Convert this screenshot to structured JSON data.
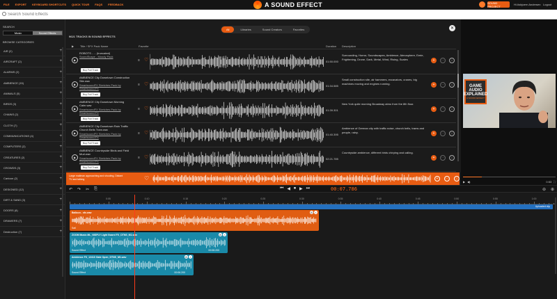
{
  "topbar": {
    "menu": [
      "FILE",
      "EXPORT",
      "KEYBOARD SHORTCUTS",
      "QUICK TOUR",
      "FAQs",
      "FEEDBACK"
    ],
    "logo_text": "A SOUND EFFECT",
    "project_button": "SOUND PROJECT",
    "user_name": "Hi Asbjoern Andersen",
    "logout": "Logout"
  },
  "search": {
    "placeholder": "Search Sound Effects"
  },
  "sidebar": {
    "search_label": "SEARCH",
    "toggle": [
      "Music",
      "Sound Effects"
    ],
    "browse_label": "BROWSE CATEGORIES",
    "categories": [
      "AIR (2)",
      "AIRCRAFT (2)",
      "ALARMS (2)",
      "AMBIENCE (15)",
      "ANIMALS (5)",
      "BIRDS (3)",
      "CHAINS (2)",
      "CLOTH (7)",
      "COMMUNICATIONS (4)",
      "COMPUTERS (2)",
      "CREATURES (2)",
      "CROWDS (3)",
      "Cartoon (2)",
      "DESIGNED (12)",
      "DIRT & SAND (3)",
      "DOORS (8)",
      "DRAWERS (7)",
      "Destruction (7)"
    ]
  },
  "main": {
    "tabs": [
      "All",
      "Libraries",
      "Sound Creators",
      "Favorites"
    ],
    "close_glyph": "✕",
    "count_label": "9621 TRACKS IN SOUND EFFECTS",
    "columns": {
      "title": "Title / SFX Pack Name",
      "favorite": "Favorite",
      "duration": "Duration",
      "description": "Description"
    },
    "rows": [
      {
        "title": "ROBOTS - ... (truncated)",
        "pack": "SoundScape - Moody Pack",
        "duration": "01:50.000",
        "description": "Surrounding, Horror, Soundscapes, Ambience, Atmosphere, Eerie, Frightening, Drone, Dark, Metal, Wind, Rising, Scales",
        "buy": "Buy Full Track"
      },
      {
        "title": "AMBIENCE City Downtown Construction Site.wav",
        "pack": "SmartsoundFX Sketches Pack by Smartsound.FX",
        "duration": "01:34.585",
        "description": "Small construction site, air hammers, excavators, cranes, big machines moving and engines running.",
        "buy": "Buy Full Track"
      },
      {
        "title": "AMBIENCE City Downtown Morning Calm.wav",
        "pack": "SmartsoundFX Sketches Pack by Smartsound.FX",
        "duration": "01:39.301",
        "description": "New York quite morning Broadway atmo from the 8th floor.",
        "buy": "Buy Full Track"
      },
      {
        "title": "AMBIENCE City Downtown Rain Traffic Church Bells Tram.wav",
        "pack": "SmartsoundFX Sketches Pack by Smartsound.FX",
        "duration": "01:40.395",
        "description": "Ambience of German city with traffic noise, church bells, trams and people, rainy.",
        "buy": "Buy Full Track"
      },
      {
        "title": "AMBIENCE Countryside Birds and Field Mud.wav",
        "pack": "SmartsoundFX Sketches Pack by Smartsound.FX",
        "duration": "02:21.785",
        "description": "Countryside ambience, different birds chirping and calling.",
        "buy": "Buy Full Track"
      }
    ],
    "now_playing": "Large mailman approaching and shouting, Distant TV and talking"
  },
  "video": {
    "book_title": "GAME AUDIO EXPLAINED",
    "book_sub": "A SOUND EFFECT",
    "time": "0:53",
    "play_glyph": "▶"
  },
  "transport": {
    "left": [
      "↶",
      "↷",
      "✂",
      "⎘"
    ],
    "controls": [
      "⏮",
      "◀",
      "⏹",
      "▶",
      "⏭"
    ],
    "time": "00:07.786",
    "right": [
      "⊖",
      "⊕"
    ]
  },
  "timeline": {
    "ruler_labels": [
      "0:05",
      "0:10",
      "0:15",
      "0:20",
      "0:25",
      "0:30",
      "0:35",
      "0:40",
      "0:45",
      "0:50",
      "0:55",
      "1:00",
      "1:05"
    ],
    "video_label": "Uploaded clip",
    "clips": [
      {
        "name": "Balloon - sfx.wav",
        "sub": "Sail",
        "duration": "",
        "color": "#e05d12"
      },
      {
        "name": "ZOOM Music ML_NISPLY Light Sword FX_DTNS_M1.wav",
        "sub": "Sound Effect",
        "duration": "00:08.200",
        "color": "#1a8aa8"
      },
      {
        "name": "Ambience FX_12410 Gate Open_DTNS_M1.wav",
        "sub": "Sound Effect",
        "duration": "00:06.200",
        "color": "#1a8aa8"
      }
    ]
  }
}
